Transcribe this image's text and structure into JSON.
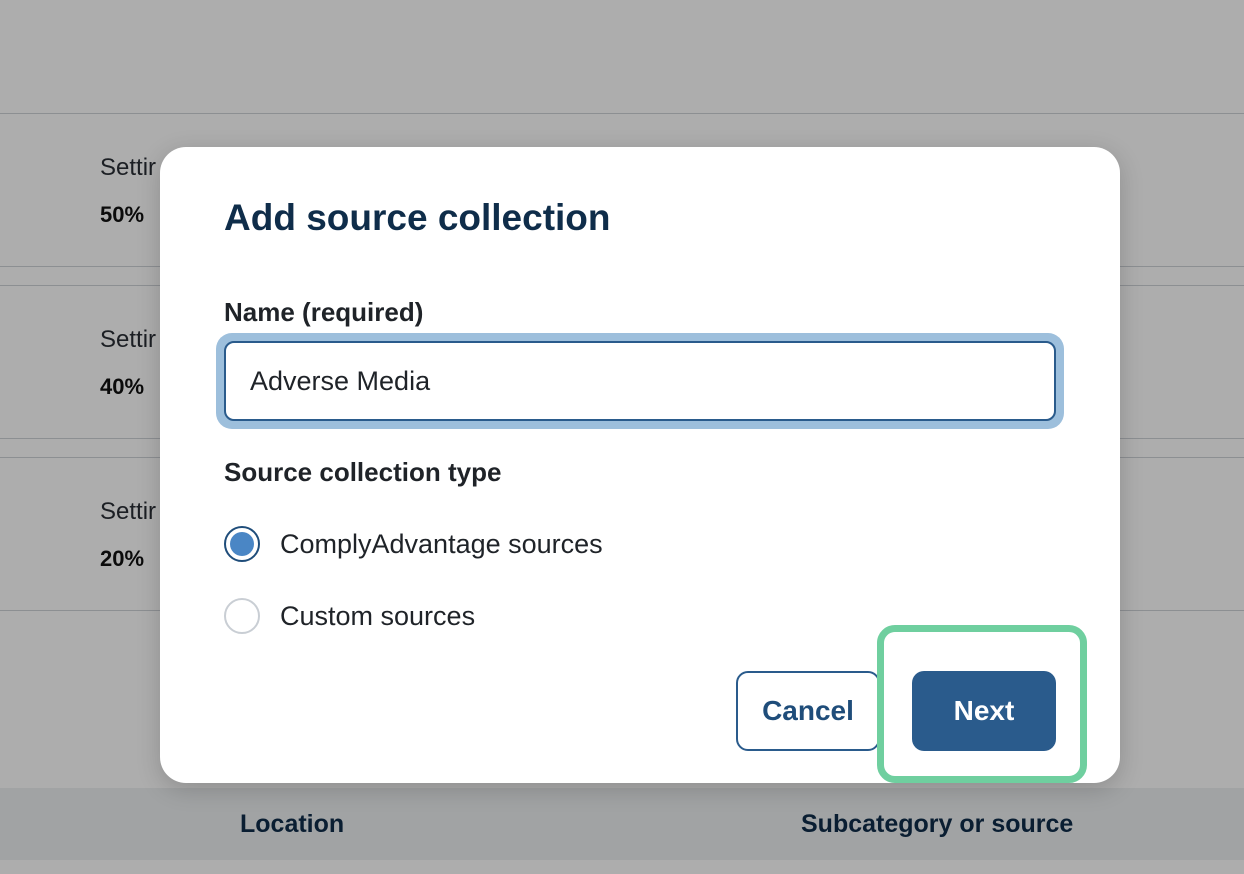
{
  "background": {
    "rows": [
      {
        "title": "Settir",
        "value": "50% "
      },
      {
        "title": "Settir",
        "value": "40% "
      },
      {
        "title": "Settir",
        "value": "20% "
      }
    ],
    "table_header": {
      "location": "Location",
      "subcategory": "Subcategory or source"
    }
  },
  "modal": {
    "title": "Add source collection",
    "name_label": "Name (required)",
    "name_value": "Adverse Media",
    "type_label": "Source collection type",
    "options": [
      {
        "label": "ComplyAdvantage sources",
        "selected": true
      },
      {
        "label": "Custom sources",
        "selected": false
      }
    ],
    "cancel_label": "Cancel",
    "next_label": "Next"
  },
  "colors": {
    "primary": "#2a5b8c",
    "title": "#0f2d4a",
    "highlight": "#6fcf9f",
    "radio_selected": "#4a86c5"
  }
}
